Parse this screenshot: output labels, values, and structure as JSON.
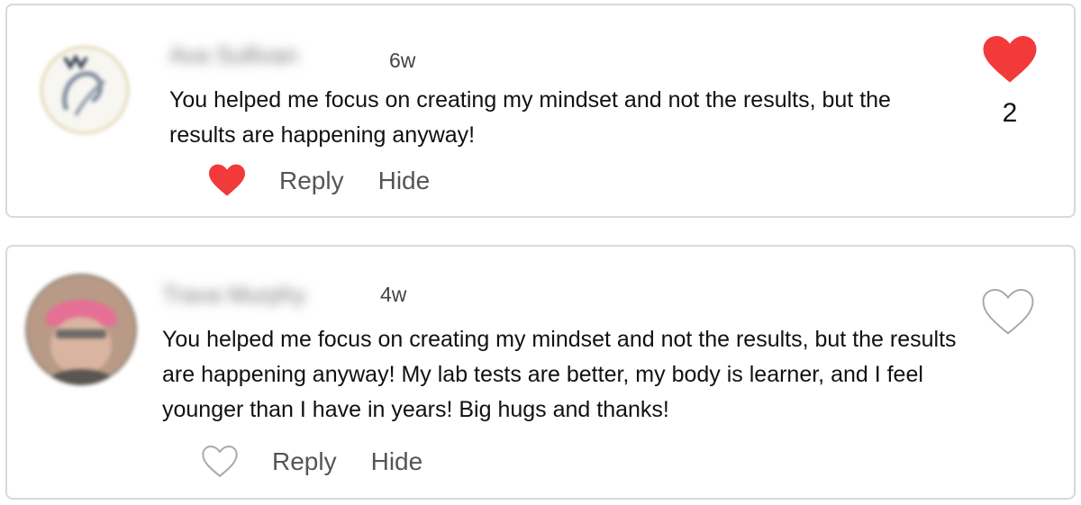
{
  "comments": [
    {
      "author": "Ava Sullivan",
      "time": "6w",
      "text": "You helped me focus on creating my mindset and not the results, but the results are happening anyway!",
      "liked": true,
      "like_count": "2",
      "actions": {
        "reply": "Reply",
        "hide": "Hide"
      }
    },
    {
      "author": "Trava Murphy",
      "time": "4w",
      "text": "You helped me focus on creating my mindset and not the results, but the results are happening anyway! My lab tests are better, my body is learner, and I feel younger than I have in years! Big hugs and thanks!",
      "liked": false,
      "actions": {
        "reply": "Reply",
        "hide": "Hide"
      }
    }
  ],
  "colors": {
    "heart_liked": "#f23a3a",
    "heart_outline": "#a9a9a9",
    "action_text": "#555555",
    "card_border": "#d9d9d9"
  },
  "icons": {
    "liked": "heart-filled-icon",
    "unliked": "heart-outline-icon"
  }
}
